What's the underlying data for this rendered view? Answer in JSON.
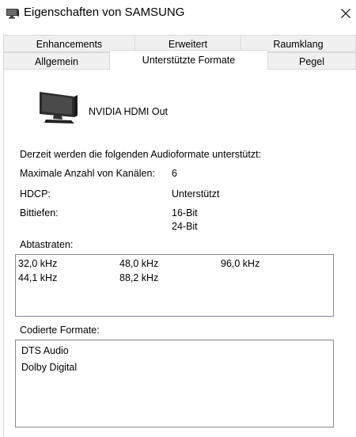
{
  "window": {
    "title": "Eigenschaften von SAMSUNG"
  },
  "tabs": {
    "row1": [
      "Enhancements",
      "Erweitert",
      "Raumklang"
    ],
    "row2": [
      "Allgemein",
      "Unterstützte Formate",
      "Pegel"
    ],
    "active": "Unterstützte Formate"
  },
  "device": {
    "icon": "monitor-icon",
    "name": "NVIDIA HDMI Out"
  },
  "info": {
    "intro": "Derzeit werden die folgenden Audioformate unterstützt:",
    "channels_label": "Maximale Anzahl von Kanälen:",
    "channels_value": "6",
    "hdcp_label": "HDCP:",
    "hdcp_value": "Unterstützt",
    "bitdepth_label": "Bittiefen:",
    "bitdepths": [
      "16-Bit",
      "24-Bit"
    ]
  },
  "sample_rates": {
    "label": "Abtastraten:",
    "values": [
      "32,0 kHz",
      "48,0 kHz",
      "96,0 kHz",
      "44,1 kHz",
      "88,2 kHz"
    ]
  },
  "encoded_formats": {
    "label": "Codierte Formate:",
    "items": [
      "DTS Audio",
      "Dolby Digital"
    ]
  }
}
